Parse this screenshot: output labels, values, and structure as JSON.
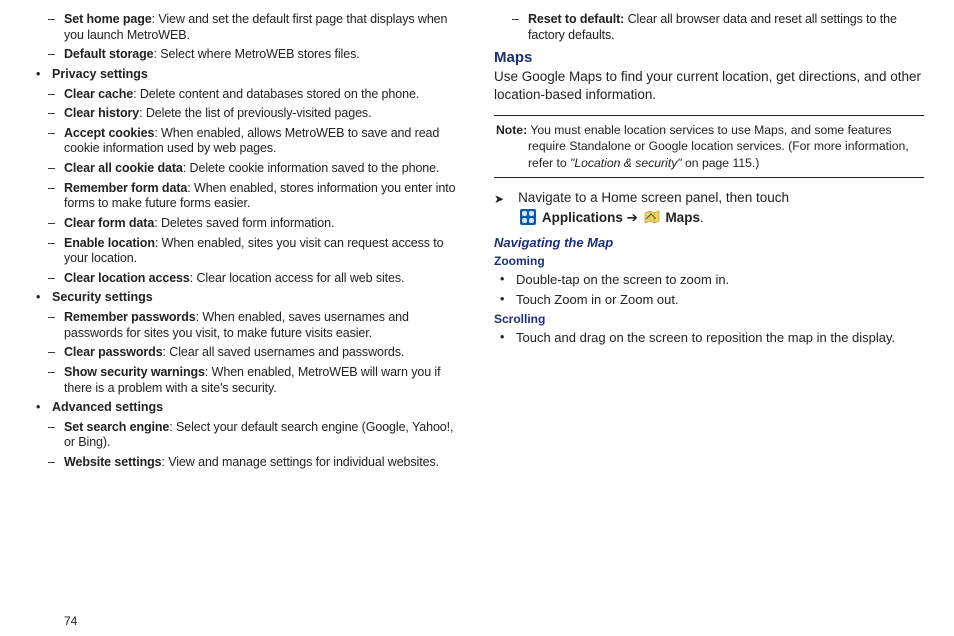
{
  "left": {
    "setHome": {
      "label": "Set home page",
      "desc": ": View and set the default first page that displays when you launch MetroWEB."
    },
    "defStorage": {
      "label": "Default storage",
      "desc": ": Select where MetroWEB  stores files."
    },
    "privacy": {
      "heading": "Privacy settings"
    },
    "clearCache": {
      "label": "Clear cache",
      "desc": ": Delete content and databases stored on the phone."
    },
    "clearHist": {
      "label": "Clear history",
      "desc": ": Delete the list of previously-visited pages."
    },
    "acceptCookies": {
      "label": "Accept cookies",
      "desc": ": When enabled, allows MetroWEB to save and read cookie information used by web pages."
    },
    "clearAllCookie": {
      "label": "Clear all cookie data",
      "desc": ": Delete cookie information saved to the phone."
    },
    "rememberForm": {
      "label": "Remember form data",
      "desc": ": When enabled, stores information you enter into forms to make future forms easier."
    },
    "clearForm": {
      "label": "Clear form data",
      "desc": ": Deletes saved form information."
    },
    "enableLoc": {
      "label": "Enable location",
      "desc": ": When enabled, sites you visit can request access to your location."
    },
    "clearLoc": {
      "label": "Clear location access",
      "desc": ": Clear location access for all web sites."
    },
    "security": {
      "heading": "Security settings"
    },
    "rememberPw": {
      "label": "Remember passwords",
      "desc": ": When enabled, saves usernames and passwords for sites you visit, to make future visits easier."
    },
    "clearPw": {
      "label": "Clear passwords",
      "desc": ": Clear all saved usernames and passwords."
    },
    "showSec": {
      "label": "Show security warnings",
      "desc": ": When enabled, MetroWEB will warn you if there is a problem with a site's security."
    },
    "advanced": {
      "heading": "Advanced settings"
    },
    "setSearch": {
      "label": "Set search engine",
      "desc": ": Select your default search engine (Google, Yahoo!, or Bing)."
    },
    "website": {
      "label": "Website settings",
      "desc": ": View and manage settings for individual websites."
    }
  },
  "right": {
    "reset": {
      "label": "Reset to default:",
      "desc": " Clear all browser data and reset all settings to the factory defaults."
    },
    "mapsHeading": "Maps",
    "mapsIntro": "Use Google Maps to find your current location, get directions, and other location-based information.",
    "noteLabel": "Note:",
    "noteFirst": " You must enable location services to use Maps, and some features ",
    "noteBody": "require Standalone or Google location services. (For more information, refer to ",
    "noteQuote": "\"Location & security\"",
    "noteTail": " on page 115.)",
    "navLine1": "Navigate to a Home screen panel, then touch",
    "navAppsLabel": "Applications",
    "navArrow": " ➔ ",
    "navMapsLabel": "Maps",
    "navPeriod": ".",
    "navMapHeading": "Navigating the Map",
    "zoomHeading": "Zooming",
    "zoom1": "Double-tap on the screen to zoom in.",
    "zoom2": "Touch Zoom in or Zoom out.",
    "scrollHeading": "Scrolling",
    "scroll1": "Touch and drag on the screen to reposition the map in the display."
  },
  "pageNumber": "74"
}
